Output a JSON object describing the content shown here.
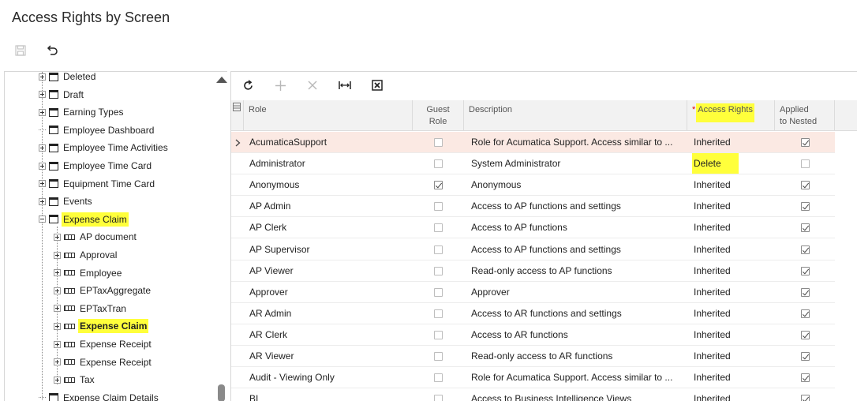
{
  "page": {
    "title": "Access Rights by Screen"
  },
  "toolbar": {
    "save_icon": "save-icon",
    "undo_icon": "undo-icon"
  },
  "tree": {
    "items": [
      {
        "label": "Deleted",
        "level": 0,
        "expandable": true,
        "icon": "screen-icon",
        "highlighted": false
      },
      {
        "label": "Draft",
        "level": 0,
        "expandable": true,
        "icon": "screen-icon",
        "highlighted": false
      },
      {
        "label": "Earning Types",
        "level": 0,
        "expandable": true,
        "icon": "screen-icon",
        "highlighted": false
      },
      {
        "label": "Employee Dashboard",
        "level": 0,
        "expandable": false,
        "icon": "screen-icon",
        "highlighted": false
      },
      {
        "label": "Employee Time Activities",
        "level": 0,
        "expandable": true,
        "icon": "screen-icon",
        "highlighted": false
      },
      {
        "label": "Employee Time Card",
        "level": 0,
        "expandable": true,
        "icon": "screen-icon",
        "highlighted": false
      },
      {
        "label": "Equipment Time Card",
        "level": 0,
        "expandable": true,
        "icon": "screen-icon",
        "highlighted": false
      },
      {
        "label": "Events",
        "level": 0,
        "expandable": true,
        "icon": "screen-icon",
        "highlighted": false
      },
      {
        "label": "Expense Claim",
        "level": 0,
        "expandable": true,
        "expanded": true,
        "icon": "screen-icon",
        "highlighted": true
      },
      {
        "label": "AP document",
        "level": 1,
        "expandable": true,
        "icon": "table-icon",
        "highlighted": false
      },
      {
        "label": "Approval",
        "level": 1,
        "expandable": true,
        "icon": "table-icon",
        "highlighted": false
      },
      {
        "label": "Employee",
        "level": 1,
        "expandable": true,
        "icon": "table-icon",
        "highlighted": false
      },
      {
        "label": "EPTaxAggregate",
        "level": 1,
        "expandable": true,
        "icon": "table-icon",
        "highlighted": false
      },
      {
        "label": "EPTaxTran",
        "level": 1,
        "expandable": true,
        "icon": "table-icon",
        "highlighted": false
      },
      {
        "label": "Expense Claim",
        "level": 1,
        "expandable": true,
        "icon": "table-icon",
        "highlighted": true,
        "bold": true
      },
      {
        "label": "Expense Receipt",
        "level": 1,
        "expandable": true,
        "icon": "table-icon",
        "highlighted": false
      },
      {
        "label": "Expense Receipt",
        "level": 1,
        "expandable": true,
        "icon": "table-icon",
        "highlighted": false
      },
      {
        "label": "Tax",
        "level": 1,
        "expandable": true,
        "icon": "table-icon",
        "highlighted": false
      },
      {
        "label": "Expense Claim Details",
        "level": 0,
        "expandable": false,
        "icon": "screen-icon",
        "highlighted": false
      }
    ]
  },
  "grid": {
    "toolbar": {
      "refresh_icon": "refresh-icon",
      "add_icon": "add-icon",
      "delete_icon": "delete-icon",
      "fit_icon": "fit-columns-icon",
      "export_icon": "export-excel-icon"
    },
    "headers": {
      "role": "Role",
      "guest_role_1": "Guest",
      "guest_role_2": "Role",
      "description": "Description",
      "access_rights_required": "*",
      "access_rights": "Access Rights",
      "applied_1": "Applied",
      "applied_2": "to Nested"
    },
    "rows": [
      {
        "role": "AcumaticaSupport",
        "guest": false,
        "description": "Role for Acumatica Support. Access similar to ...",
        "access": "Inherited",
        "nested": true,
        "active": true
      },
      {
        "role": "Administrator",
        "guest": false,
        "description": "System Administrator",
        "access": "Delete",
        "nested": false,
        "access_highlighted": true
      },
      {
        "role": "Anonymous",
        "guest": true,
        "description": "Anonymous",
        "access": "Inherited",
        "nested": true
      },
      {
        "role": "AP Admin",
        "guest": false,
        "description": "Access to AP functions and settings",
        "access": "Inherited",
        "nested": true
      },
      {
        "role": "AP Clerk",
        "guest": false,
        "description": "Access to AP functions",
        "access": "Inherited",
        "nested": true
      },
      {
        "role": "AP Supervisor",
        "guest": false,
        "description": "Access to AP functions and settings",
        "access": "Inherited",
        "nested": true
      },
      {
        "role": "AP Viewer",
        "guest": false,
        "description": "Read-only access to AP functions",
        "access": "Inherited",
        "nested": true
      },
      {
        "role": "Approver",
        "guest": false,
        "description": "Approver",
        "access": "Inherited",
        "nested": true
      },
      {
        "role": "AR Admin",
        "guest": false,
        "description": "Access to AR functions and settings",
        "access": "Inherited",
        "nested": true
      },
      {
        "role": "AR Clerk",
        "guest": false,
        "description": "Access to AR functions",
        "access": "Inherited",
        "nested": true
      },
      {
        "role": "AR Viewer",
        "guest": false,
        "description": "Read-only access to AR functions",
        "access": "Inherited",
        "nested": true
      },
      {
        "role": "Audit - Viewing Only",
        "guest": false,
        "description": "Role for Acumatica Support. Access similar to ...",
        "access": "Inherited",
        "nested": true
      },
      {
        "role": "BI",
        "guest": false,
        "description": "Access to Business Intelligence Views",
        "access": "Inherited",
        "nested": true
      }
    ]
  },
  "colors": {
    "highlight": "#ffff3b",
    "active_row": "#fbe9e3",
    "header_bg": "#f2f2f2"
  }
}
